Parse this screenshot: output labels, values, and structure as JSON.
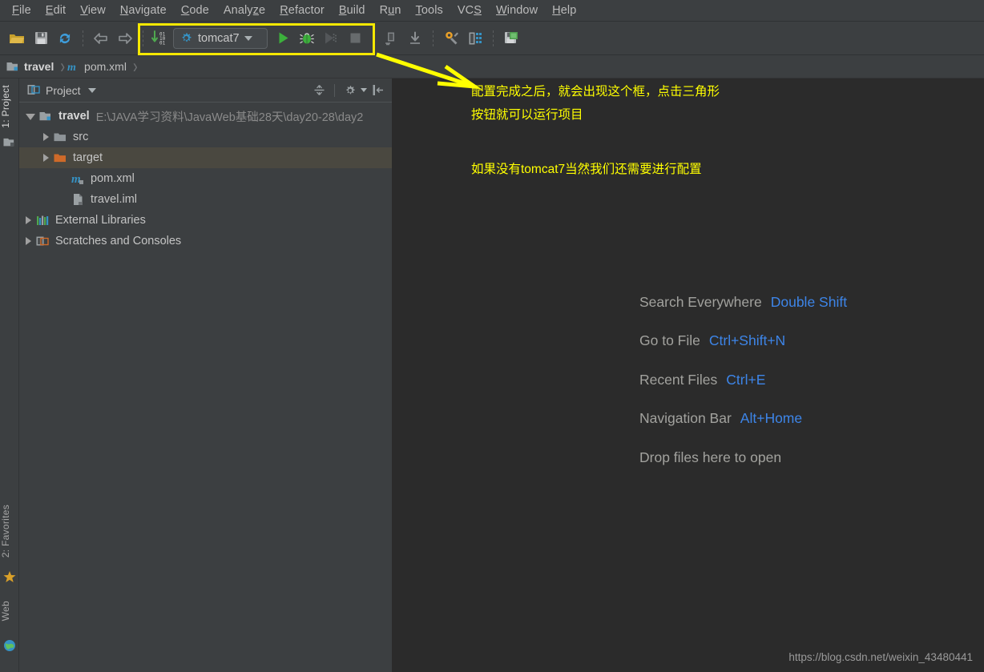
{
  "menu": {
    "items": [
      {
        "label": "File",
        "accel": "F"
      },
      {
        "label": "Edit",
        "accel": "E"
      },
      {
        "label": "View",
        "accel": "V"
      },
      {
        "label": "Navigate",
        "accel": "N"
      },
      {
        "label": "Code",
        "accel": "C"
      },
      {
        "label": "Analyze",
        "accel": "z"
      },
      {
        "label": "Refactor",
        "accel": "R"
      },
      {
        "label": "Build",
        "accel": "B"
      },
      {
        "label": "Run",
        "accel": "u"
      },
      {
        "label": "Tools",
        "accel": "T"
      },
      {
        "label": "VCS",
        "accel": "S"
      },
      {
        "label": "Window",
        "accel": "W"
      },
      {
        "label": "Help",
        "accel": "H"
      }
    ]
  },
  "toolbar": {
    "open_project": "open-project-icon",
    "save_all": "save-all-icon",
    "sync": "synchronize-icon",
    "back": "navigate-back-icon",
    "forward": "navigate-forward-icon",
    "compile": "compile-icon",
    "run_config_name": "tomcat7",
    "run": "run-icon",
    "debug": "debug-icon",
    "coverage": "run-with-coverage-icon",
    "stop": "stop-icon",
    "update_project": "update-project-icon",
    "pull": "pull-icon",
    "settings": "settings-icon",
    "project_structure": "project-structure-icon",
    "save_all_right": "save-all-green-icon"
  },
  "breadcrumb": {
    "project": "travel",
    "file": "pom.xml"
  },
  "left_strip": {
    "project_tab": "1: Project",
    "favorites_tab": "2: Favorites",
    "web_tab": "Web"
  },
  "project_panel": {
    "title": "Project",
    "collapse_all": "collapse-all-icon",
    "settings": "panel-settings-icon",
    "hide": "hide-panel-icon",
    "tree": [
      {
        "label": "travel",
        "path": "E:\\JAVA学习资料\\JavaWeb基础28天\\day20-28\\day2",
        "icon": "module-icon",
        "state": "open",
        "indent": 0,
        "bold": true,
        "selected": false
      },
      {
        "label": "src",
        "path": "",
        "icon": "folder-icon",
        "state": "closed",
        "indent": 1,
        "bold": false,
        "selected": false
      },
      {
        "label": "target",
        "path": "",
        "icon": "folder-orange-icon",
        "state": "closed",
        "indent": 1,
        "bold": false,
        "selected": true
      },
      {
        "label": "pom.xml",
        "path": "",
        "icon": "maven-icon",
        "state": "leaf",
        "indent": 2,
        "bold": false,
        "selected": false
      },
      {
        "label": "travel.iml",
        "path": "",
        "icon": "iml-icon",
        "state": "leaf",
        "indent": 2,
        "bold": false,
        "selected": false
      },
      {
        "label": "External Libraries",
        "path": "",
        "icon": "libraries-icon",
        "state": "closed",
        "indent": 0,
        "bold": false,
        "selected": false
      },
      {
        "label": "Scratches and Consoles",
        "path": "",
        "icon": "scratches-icon",
        "state": "closed",
        "indent": 0,
        "bold": false,
        "selected": false
      }
    ]
  },
  "annotations": {
    "line1": "配置完成之后，就会出现这个框，点击三角形",
    "line2": "按钮就可以运行项目",
    "line3": "如果没有tomcat7当然我们还需要进行配置",
    "color": "#ffff00"
  },
  "editor": {
    "shortcuts": [
      {
        "name": "Search Everywhere",
        "key": "Double Shift"
      },
      {
        "name": "Go to File",
        "key": "Ctrl+Shift+N"
      },
      {
        "name": "Recent Files",
        "key": "Ctrl+E"
      },
      {
        "name": "Navigation Bar",
        "key": "Alt+Home"
      },
      {
        "name": "Drop files here to open",
        "key": ""
      }
    ],
    "watermark": "https://blog.csdn.net/weixin_43480441"
  },
  "colors": {
    "panel_bg": "#3c3f41",
    "editor_bg": "#2b2b2b",
    "accent_blue": "#3d85e8",
    "highlight_yellow": "#f5e800",
    "selection": "#4a4840"
  }
}
